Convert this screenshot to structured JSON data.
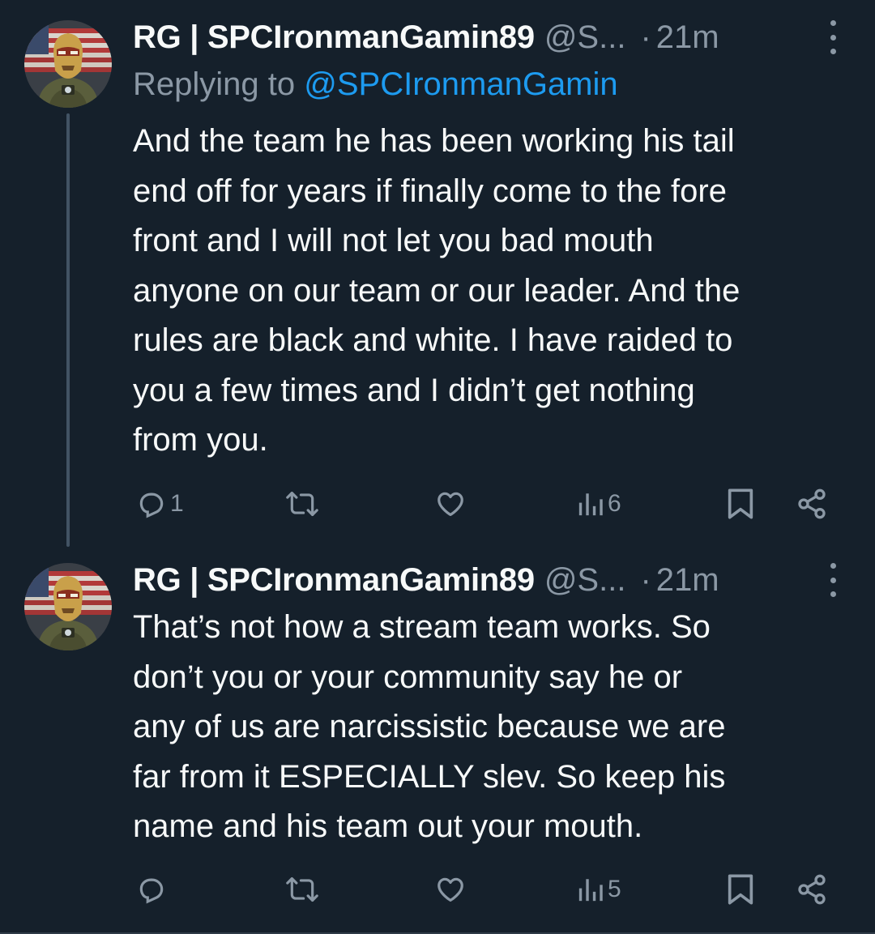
{
  "tweets": [
    {
      "display_name": "RG | SPCIronmanGamin89",
      "handle": "@S...",
      "separator": "·",
      "time": "21m",
      "replying_label": "Replying to ",
      "replying_to": "@SPCIronmanGamin",
      "text": "And the team he has been working his tail\nend off for years if finally come to the fore\nfront and I will not let you bad mouth\nanyone on our team or our leader. And the\nrules are black and white. I have raided to\nyou a few times and I didn’t get nothing\nfrom you.",
      "reply_count": "1",
      "retweet_count": "",
      "like_count": "",
      "view_count": "6",
      "icons": [
        "reply-icon",
        "retweet-icon",
        "like-icon",
        "views-icon",
        "bookmark-icon",
        "share-icon"
      ]
    },
    {
      "display_name": "RG | SPCIronmanGamin89",
      "handle": "@S...",
      "separator": "·",
      "time": "21m",
      "text": "That’s not how a stream team works. So\ndon’t you or your community say he or\nany of us are narcissistic because we are\nfar from it ESPECIALLY slev. So keep his\nname and his team out your mouth.",
      "reply_count": "",
      "retweet_count": "",
      "like_count": "",
      "view_count": "5",
      "icons": [
        "reply-icon",
        "retweet-icon",
        "like-icon",
        "views-icon",
        "bookmark-icon",
        "share-icon"
      ]
    }
  ],
  "colors": {
    "background": "#15202b",
    "text": "#f7f9f9",
    "secondary": "#8b98a5",
    "link": "#1d9bf0",
    "thread_line": "#425364"
  }
}
